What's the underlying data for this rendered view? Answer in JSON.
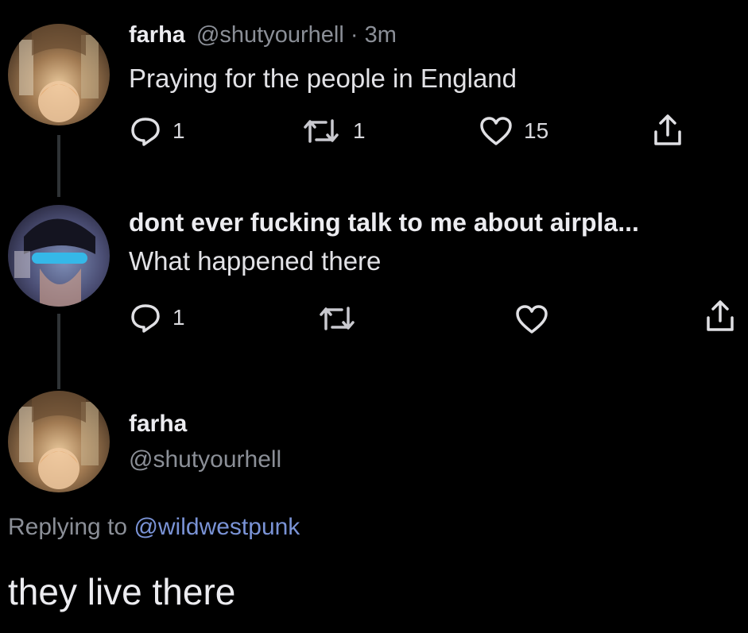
{
  "tweet1": {
    "display_name": "farha",
    "handle": "@shutyourhell",
    "separator": "·",
    "time": "3m",
    "text": "Praying for the people in England",
    "actions": {
      "reply_count": "1",
      "retweet_count": "1",
      "like_count": "15"
    }
  },
  "tweet2": {
    "display_name": "dont ever fucking talk to me about airpla...",
    "text": "What happened there",
    "actions": {
      "reply_count": "1"
    }
  },
  "tweet3": {
    "display_name": "farha",
    "handle": "@shutyourhell",
    "replying_prefix": "Replying to",
    "replying_handle": "@wildwestpunk",
    "text": "they live there"
  },
  "icons": {
    "reply": "speech-bubble-icon",
    "retweet": "retweet-arrows-icon",
    "like": "heart-icon",
    "share": "share-upload-icon"
  },
  "colors": {
    "background": "#000000",
    "text": "#e6e6ea",
    "muted": "#8b8f97",
    "link": "#7a93d6"
  }
}
